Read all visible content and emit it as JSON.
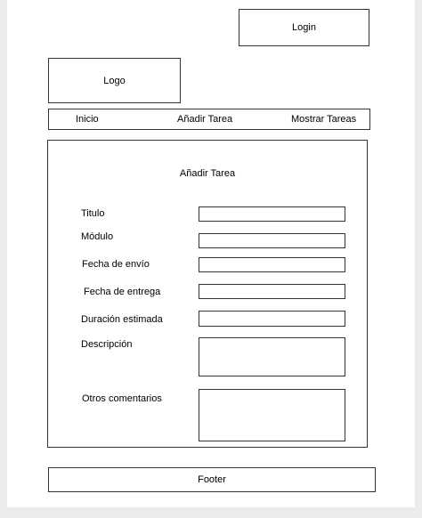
{
  "header": {
    "login_label": "Login",
    "logo_label": "Logo"
  },
  "nav": {
    "items": [
      {
        "label": "Inicio"
      },
      {
        "label": "Añadir Tarea"
      },
      {
        "label": "Mostrar Tareas"
      }
    ]
  },
  "form": {
    "title": "Añadir Tarea",
    "fields": [
      {
        "label": "Titulo",
        "value": ""
      },
      {
        "label": "Módulo",
        "value": ""
      },
      {
        "label": "Fecha de envío",
        "value": ""
      },
      {
        "label": "Fecha de entrega",
        "value": ""
      },
      {
        "label": "Duración estimada",
        "value": ""
      },
      {
        "label": "Descripción",
        "value": ""
      },
      {
        "label": "Otros comentarios",
        "value": ""
      }
    ]
  },
  "footer": {
    "label": "Footer"
  }
}
